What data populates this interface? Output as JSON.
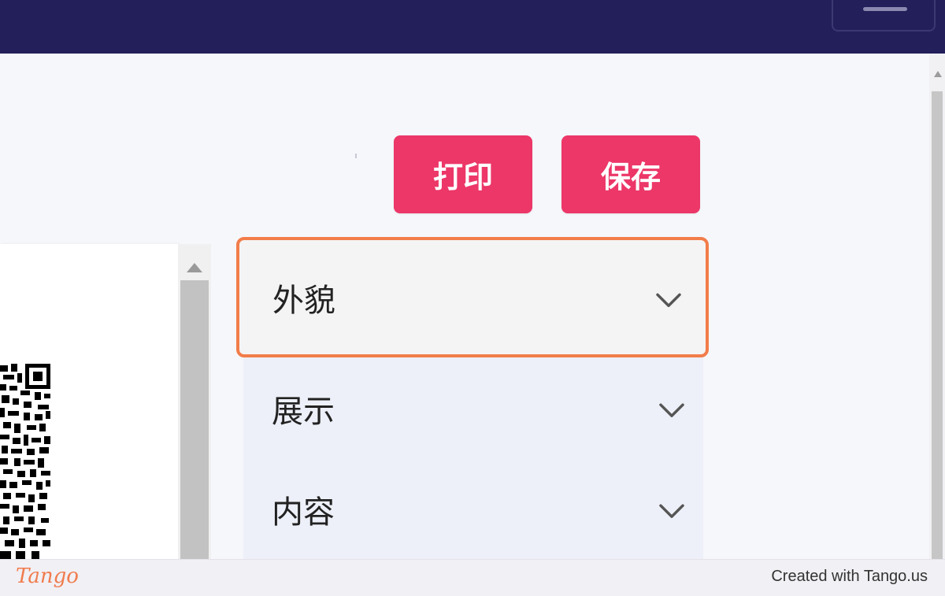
{
  "toolbar": {
    "print_label": "打印",
    "save_label": "保存"
  },
  "accordion": {
    "items": [
      {
        "label": "外貌",
        "highlighted": true
      },
      {
        "label": "展示",
        "highlighted": false
      },
      {
        "label": "内容",
        "highlighted": false
      }
    ]
  },
  "colors": {
    "header": "#221f5a",
    "primary_button": "#ec3768",
    "highlight_border": "#f27d4a"
  },
  "footer": {
    "brand": "Tango",
    "created_text": "Created with Tango.us"
  },
  "icons": {
    "menu": "hamburger-icon",
    "chevron": "chevron-down-icon",
    "qr": "qr-code-icon"
  }
}
